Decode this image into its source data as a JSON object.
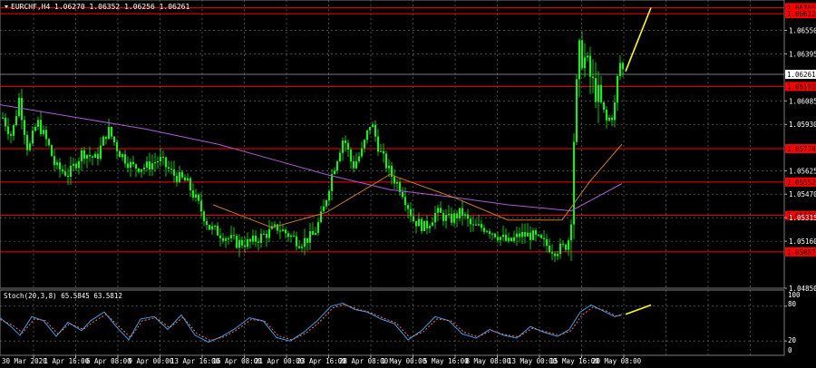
{
  "header": {
    "symbol_label": "EURCHF,H4",
    "ohlc": "1.06270 1.06352 1.06256 1.06261"
  },
  "stoch_panel": {
    "label": "Stoch(20,3,8) 65.5845 63.5812",
    "scale_labels": [
      "100",
      "80",
      "20",
      "0"
    ]
  },
  "colors": {
    "background": "#000000",
    "candle": "#00ff00",
    "grid": "#777777",
    "level_line": "#ff0000",
    "level_label_bg": "#ff0000",
    "current_price_line": "#9aa0a6",
    "ma_fast": "#c77a1a",
    "ma_slow": "#b05ad8",
    "forecast_arrow": "#ffff00",
    "stoch_main": "#3aa0e8",
    "stoch_signal": "#ff6a6a"
  },
  "chart_data": {
    "type": "candlestick",
    "symbol": "EURCHF",
    "timeframe": "H4",
    "ylim": [
      1.0485,
      1.0675
    ],
    "y_ticks": [
      "1.06550",
      "1.06395",
      "1.06085",
      "1.05930",
      "1.05625",
      "1.05470",
      "1.05315",
      "1.05160",
      "1.04850"
    ],
    "level_lines": [
      {
        "price": 1.067,
        "label": "1.06705"
      },
      {
        "price": 1.0666,
        "label": "1.06612"
      },
      {
        "price": 1.0618,
        "label": "1.06183"
      },
      {
        "price": 1.0577,
        "label": "1.05774"
      },
      {
        "price": 1.0555,
        "label": "1.05552"
      },
      {
        "price": 1.0533,
        "label": "1.05323"
      },
      {
        "price": 1.0509,
        "label": "1.05087"
      }
    ],
    "current_price": {
      "price": 1.0626,
      "label": "1.06261"
    },
    "x_labels": [
      "30 Mar 2020",
      "1 Apr 16:00",
      "6 Apr 08:00",
      "9 Apr 00:00",
      "13 Apr 16:00",
      "16 Apr 08:00",
      "21 Apr 00:00",
      "23 Apr 16:00",
      "28 Apr 08:00",
      "1 May 00:00",
      "5 May 16:00",
      "8 May 08:00",
      "13 May 00:00",
      "15 May 16:00",
      "20 May 08:00"
    ],
    "close_path": [
      [
        0,
        1.06
      ],
      [
        12,
        1.0585
      ],
      [
        20,
        1.061
      ],
      [
        30,
        1.0575
      ],
      [
        40,
        1.0595
      ],
      [
        52,
        1.058
      ],
      [
        60,
        1.0565
      ],
      [
        75,
        1.056
      ],
      [
        90,
        1.0575
      ],
      [
        105,
        1.057
      ],
      [
        118,
        1.059
      ],
      [
        130,
        1.0575
      ],
      [
        145,
        1.0565
      ],
      [
        160,
        1.0565
      ],
      [
        175,
        1.057
      ],
      [
        190,
        1.056
      ],
      [
        205,
        1.0555
      ],
      [
        218,
        1.054
      ],
      [
        230,
        1.0525
      ],
      [
        245,
        1.052
      ],
      [
        260,
        1.0515
      ],
      [
        275,
        1.0515
      ],
      [
        290,
        1.052
      ],
      [
        305,
        1.0525
      ],
      [
        318,
        1.052
      ],
      [
        330,
        1.0515
      ],
      [
        345,
        1.052
      ],
      [
        355,
        1.0535
      ],
      [
        365,
        1.056
      ],
      [
        378,
        1.0585
      ],
      [
        388,
        1.0565
      ],
      [
        398,
        1.0575
      ],
      [
        408,
        1.0595
      ],
      [
        418,
        1.0575
      ],
      [
        430,
        1.056
      ],
      [
        442,
        1.055
      ],
      [
        455,
        1.053
      ],
      [
        468,
        1.0525
      ],
      [
        480,
        1.0535
      ],
      [
        495,
        1.053
      ],
      [
        508,
        1.0535
      ],
      [
        520,
        1.0525
      ],
      [
        535,
        1.0525
      ],
      [
        548,
        1.052
      ],
      [
        560,
        1.0515
      ],
      [
        572,
        1.052
      ],
      [
        585,
        1.052
      ],
      [
        598,
        1.0515
      ],
      [
        610,
        1.051
      ],
      [
        622,
        1.0512
      ],
      [
        628,
        1.052
      ],
      [
        633,
        1.06
      ],
      [
        638,
        1.064
      ],
      [
        645,
        1.0635
      ],
      [
        652,
        1.062
      ],
      [
        660,
        1.061
      ],
      [
        668,
        1.0595
      ],
      [
        676,
        1.06
      ],
      [
        682,
        1.0635
      ],
      [
        688,
        1.0626
      ]
    ],
    "ma_fast_path": [
      [
        235,
        1.054
      ],
      [
        300,
        1.0525
      ],
      [
        360,
        1.0535
      ],
      [
        430,
        1.056
      ],
      [
        500,
        1.0545
      ],
      [
        560,
        1.053
      ],
      [
        620,
        1.053
      ],
      [
        650,
        1.0555
      ],
      [
        686,
        1.058
      ]
    ],
    "ma_slow_path": [
      [
        0,
        1.0606
      ],
      [
        80,
        1.0598
      ],
      [
        160,
        1.059
      ],
      [
        240,
        1.058
      ],
      [
        300,
        1.057
      ],
      [
        360,
        1.056
      ],
      [
        430,
        1.055
      ],
      [
        500,
        1.0545
      ],
      [
        560,
        1.054
      ],
      [
        630,
        1.0536
      ],
      [
        686,
        1.0554
      ]
    ],
    "forecast_arrow": [
      [
        690,
        1.0628
      ],
      [
        718,
        1.067
      ]
    ]
  },
  "stoch_data": {
    "ylim": [
      0,
      100
    ],
    "main_path": [
      [
        0,
        60
      ],
      [
        12,
        45
      ],
      [
        22,
        30
      ],
      [
        35,
        62
      ],
      [
        48,
        55
      ],
      [
        62,
        28
      ],
      [
        75,
        52
      ],
      [
        90,
        38
      ],
      [
        100,
        55
      ],
      [
        115,
        70
      ],
      [
        128,
        45
      ],
      [
        142,
        22
      ],
      [
        155,
        58
      ],
      [
        170,
        62
      ],
      [
        185,
        40
      ],
      [
        200,
        65
      ],
      [
        215,
        30
      ],
      [
        230,
        18
      ],
      [
        245,
        28
      ],
      [
        260,
        42
      ],
      [
        275,
        60
      ],
      [
        290,
        55
      ],
      [
        305,
        26
      ],
      [
        320,
        20
      ],
      [
        335,
        35
      ],
      [
        350,
        55
      ],
      [
        365,
        80
      ],
      [
        378,
        85
      ],
      [
        392,
        74
      ],
      [
        405,
        70
      ],
      [
        420,
        58
      ],
      [
        435,
        50
      ],
      [
        450,
        22
      ],
      [
        465,
        38
      ],
      [
        480,
        62
      ],
      [
        495,
        55
      ],
      [
        510,
        32
      ],
      [
        525,
        25
      ],
      [
        540,
        40
      ],
      [
        555,
        30
      ],
      [
        570,
        25
      ],
      [
        585,
        45
      ],
      [
        600,
        35
      ],
      [
        615,
        28
      ],
      [
        628,
        40
      ],
      [
        640,
        70
      ],
      [
        652,
        82
      ],
      [
        665,
        72
      ],
      [
        678,
        62
      ],
      [
        686,
        66
      ]
    ],
    "signal_path": [
      [
        0,
        57
      ],
      [
        14,
        47
      ],
      [
        25,
        34
      ],
      [
        38,
        58
      ],
      [
        50,
        55
      ],
      [
        64,
        32
      ],
      [
        77,
        50
      ],
      [
        92,
        40
      ],
      [
        103,
        53
      ],
      [
        117,
        66
      ],
      [
        130,
        47
      ],
      [
        144,
        26
      ],
      [
        157,
        55
      ],
      [
        172,
        60
      ],
      [
        187,
        43
      ],
      [
        202,
        61
      ],
      [
        217,
        33
      ],
      [
        232,
        21
      ],
      [
        247,
        27
      ],
      [
        262,
        40
      ],
      [
        277,
        57
      ],
      [
        292,
        54
      ],
      [
        307,
        29
      ],
      [
        322,
        22
      ],
      [
        337,
        33
      ],
      [
        352,
        52
      ],
      [
        367,
        77
      ],
      [
        380,
        83
      ],
      [
        394,
        75
      ],
      [
        407,
        70
      ],
      [
        422,
        60
      ],
      [
        437,
        51
      ],
      [
        452,
        26
      ],
      [
        467,
        36
      ],
      [
        482,
        58
      ],
      [
        497,
        55
      ],
      [
        512,
        35
      ],
      [
        527,
        27
      ],
      [
        542,
        38
      ],
      [
        557,
        31
      ],
      [
        572,
        27
      ],
      [
        587,
        42
      ],
      [
        602,
        36
      ],
      [
        617,
        30
      ],
      [
        630,
        38
      ],
      [
        642,
        65
      ],
      [
        654,
        78
      ],
      [
        667,
        73
      ],
      [
        680,
        63
      ],
      [
        686,
        64
      ]
    ],
    "forecast_arrow": [
      [
        690,
        66
      ],
      [
        718,
        82
      ]
    ]
  }
}
